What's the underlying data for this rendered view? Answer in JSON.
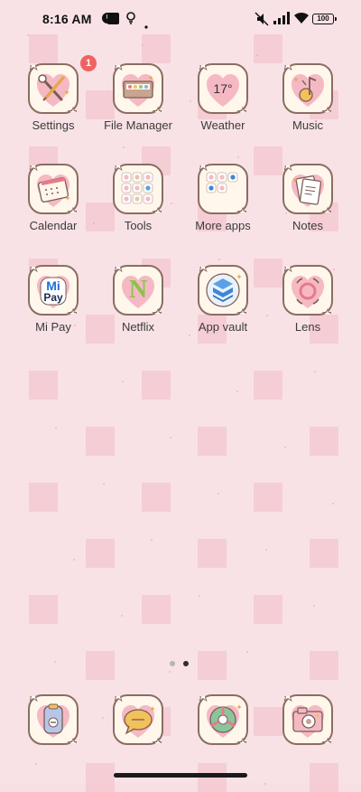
{
  "status_bar": {
    "time": "8:16 AM",
    "battery": "100",
    "icons": [
      "clock-app-icon",
      "media-stop-icon",
      "location-pin-icon",
      "dot-icon",
      "mute-vibrate-icon",
      "signal-icon",
      "wifi-icon",
      "battery-icon"
    ]
  },
  "apps": [
    {
      "label": "Settings",
      "icon": "wrench-screwdriver-icon",
      "badge": "1"
    },
    {
      "label": "File Manager",
      "icon": "folder-tray-icon"
    },
    {
      "label": "Weather",
      "icon": "weather-heart-icon",
      "value": "17°"
    },
    {
      "label": "Music",
      "icon": "music-note-icon"
    },
    {
      "label": "Calendar",
      "icon": "calendar-icon"
    },
    {
      "label": "Tools",
      "icon": "tools-folder-icon"
    },
    {
      "label": "More apps",
      "icon": "more-apps-folder-icon"
    },
    {
      "label": "Notes",
      "icon": "notes-icon"
    },
    {
      "label": "Mi Pay",
      "icon": "mi-pay-icon",
      "logo_top": "Mi",
      "logo_bottom": "Pay"
    },
    {
      "label": "Netflix",
      "icon": "netflix-icon",
      "logo": "N"
    },
    {
      "label": "App vault",
      "icon": "app-vault-icon"
    },
    {
      "label": "Lens",
      "icon": "lens-icon"
    }
  ],
  "dock": [
    {
      "icon": "phone-icon"
    },
    {
      "icon": "messages-icon"
    },
    {
      "icon": "browser-icon"
    },
    {
      "icon": "camera-icon"
    }
  ],
  "page_indicator": {
    "pages": 2,
    "current": 2
  },
  "colors": {
    "frame": "#8b6d62",
    "heart": "#f5b9c4",
    "badge": "#f06262",
    "wallpaper": "#f8e2e6",
    "tile": "#f4c6cf"
  }
}
